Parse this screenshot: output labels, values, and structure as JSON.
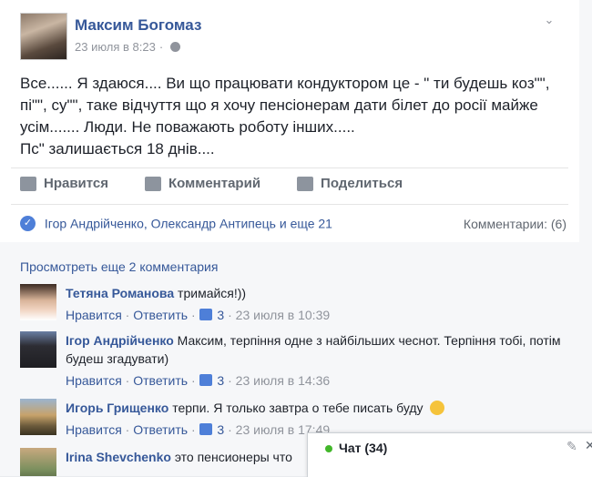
{
  "post": {
    "author": "Максим Богомаз",
    "date": "23 июля в 8:23",
    "date_suffix": "·",
    "text_lines": [
      "Все...... Я здаюся.... Ви що працювати кондуктором це - \" ти будешь коз\"\",",
      "пі\"\", су\"\", таке відчуття що я хочу пенсіонерам дати білет до росії майже",
      "усім....... Люди. Не поважають роботу інших.....",
      "Пс\" залишається 18 днів...."
    ]
  },
  "actions": {
    "like": "Нравится",
    "comment": "Комментарий",
    "share": "Поделиться"
  },
  "reactions": {
    "likers": "Ігор Андрійченко, Олександр Антипець и еще 21",
    "comment_count": "Комментарии: (6)"
  },
  "comments": {
    "view_more": "Просмотреть еще 2 комментария",
    "items": [
      {
        "name": "Тетяна Романова",
        "text": "тримайся!))",
        "like_label": "Нравится",
        "reply_label": "Ответить",
        "likes": "3",
        "time": "23 июля в 10:39"
      },
      {
        "name": "Ігор Андрійченко",
        "text": "Максим, терпіння одне з найбільших чеснот. Терпіння тобі, потім будеш згадувати)",
        "like_label": "Нравится",
        "reply_label": "Ответить",
        "likes": "3",
        "time": "23 июля в 14:36"
      },
      {
        "name": "Игорь Грищенко",
        "text": "терпи. Я только завтра о тебе писать буду",
        "like_label": "Нравится",
        "reply_label": "Ответить",
        "likes": "3",
        "time": "23 июля в 17:49"
      },
      {
        "name": "Irina Shevchenko",
        "text": "это пенсионеры что"
      }
    ]
  },
  "chat": {
    "label": "Чат (34)"
  },
  "colors": {
    "link": "#365899",
    "muted": "#90949c",
    "online": "#42b72a",
    "like_blue": "#4e7fd8"
  }
}
